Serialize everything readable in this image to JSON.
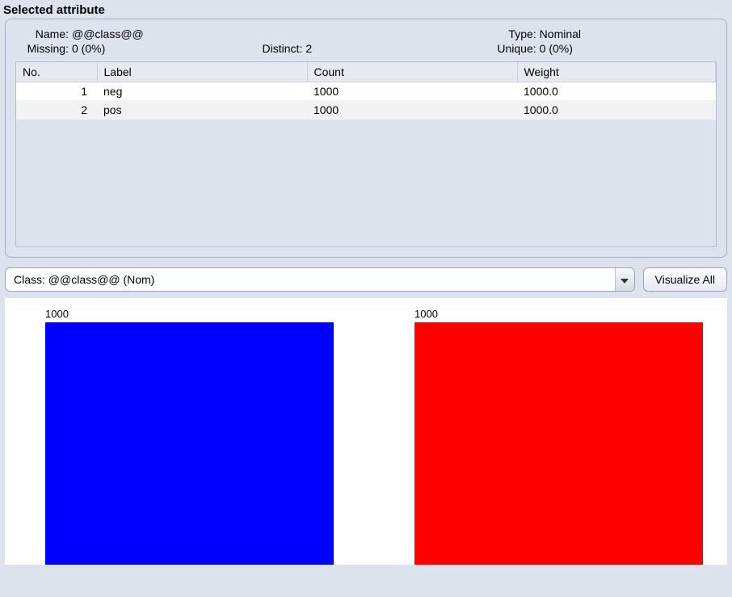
{
  "panel_title": "Selected attribute",
  "meta": {
    "name_label": "Name:",
    "name_value": "@@class@@",
    "type_label": "Type:",
    "type_value": "Nominal",
    "missing_label": "Missing:",
    "missing_value": "0 (0%)",
    "distinct_label": "Distinct:",
    "distinct_value": "2",
    "unique_label": "Unique:",
    "unique_value": "0 (0%)"
  },
  "table": {
    "headers": {
      "no": "No.",
      "label": "Label",
      "count": "Count",
      "weight": "Weight"
    },
    "rows": [
      {
        "no": "1",
        "label": "neg",
        "count": "1000",
        "weight": "1000.0"
      },
      {
        "no": "2",
        "label": "pos",
        "count": "1000",
        "weight": "1000.0"
      }
    ]
  },
  "controls": {
    "class_selector": "Class: @@class@@ (Nom)",
    "visualize_button": "Visualize All"
  },
  "chart_data": {
    "type": "bar",
    "categories": [
      "neg",
      "pos"
    ],
    "values": [
      1000,
      1000
    ],
    "colors": [
      "#0000ff",
      "#ff0000"
    ],
    "ylim": [
      0,
      1000
    ],
    "labels": [
      "1000",
      "1000"
    ]
  }
}
